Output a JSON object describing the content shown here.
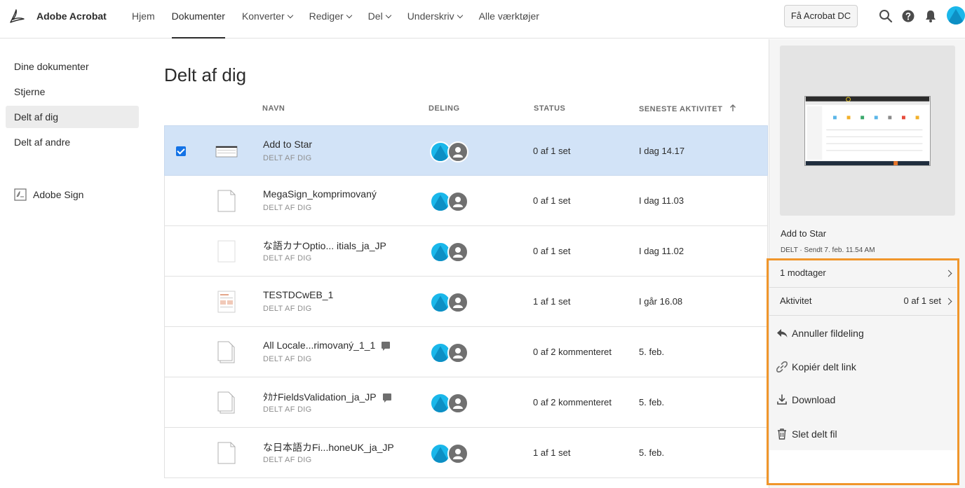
{
  "app": {
    "name": "Adobe Acrobat"
  },
  "nav": {
    "items": [
      {
        "label": "Hjem",
        "dropdown": false
      },
      {
        "label": "Dokumenter",
        "dropdown": false,
        "active": true
      },
      {
        "label": "Konverter",
        "dropdown": true
      },
      {
        "label": "Rediger",
        "dropdown": true
      },
      {
        "label": "Del",
        "dropdown": true
      },
      {
        "label": "Underskriv",
        "dropdown": true
      },
      {
        "label": "Alle værktøjer",
        "dropdown": false
      }
    ],
    "cta_label": "Få Acrobat DC",
    "icons": [
      "search-icon",
      "help-icon",
      "bell-icon",
      "avatar"
    ]
  },
  "sidebar": {
    "items": [
      {
        "label": "Dine dokumenter"
      },
      {
        "label": "Stjerne"
      },
      {
        "label": "Delt af dig",
        "active": true
      },
      {
        "label": "Delt af andre"
      }
    ],
    "sign_label": "Adobe Sign"
  },
  "main": {
    "title": "Delt af dig",
    "columns": {
      "name": "NAVN",
      "sharing": "DELING",
      "status": "STATUS",
      "activity": "SENESTE AKTIVITET"
    },
    "rows": [
      {
        "name": "Add to Star",
        "sub": "DELT AF DIG",
        "status": "0 af 1 set",
        "activity": "I dag 14.17",
        "selected": true,
        "comment": false,
        "thumb": "screenshot"
      },
      {
        "name": "MegaSign_komprimovaný",
        "sub": "DELT AF DIG",
        "status": "0 af 1 set",
        "activity": "I dag 11.03",
        "comment": false,
        "thumb": "doc"
      },
      {
        "name": "な語カナOptio...  itials_ja_JP",
        "sub": "DELT AF DIG",
        "status": "0 af 1 set",
        "activity": "I dag 11.02",
        "comment": false,
        "thumb": "blank"
      },
      {
        "name": "TESTDCwEB_1",
        "sub": "DELT AF DIG",
        "status": "1 af 1 set",
        "activity": "I går 16.08",
        "comment": false,
        "thumb": "form"
      },
      {
        "name": "All Locale...rimovaný_1_1",
        "sub": "DELT AF DIG",
        "status": "0 af 2 kommenteret",
        "activity": "5. feb.",
        "comment": true,
        "thumb": "stack"
      },
      {
        "name": "ﾀｶﾅFieldsValidation_ja_JP",
        "sub": "DELT AF DIG",
        "status": "0 af 2 kommenteret",
        "activity": "5. feb.",
        "comment": true,
        "thumb": "stack"
      },
      {
        "name": "な日本語カFi...honeUK_ja_JP",
        "sub": "DELT AF DIG",
        "status": "1 af 1 set",
        "activity": "5. feb.",
        "comment": false,
        "thumb": "doc"
      }
    ]
  },
  "panel": {
    "title": "Add to Star",
    "meta": "DELT  ·  Sendt 7. feb. 11.54 AM",
    "recipients": "1 modtager",
    "activity_label": "Aktivitet",
    "activity_value": "0 af 1 set",
    "actions": [
      {
        "label": "Annuller fildeling",
        "icon": "unshare-icon"
      },
      {
        "label": "Kopiér delt link",
        "icon": "link-icon"
      },
      {
        "label": "Download",
        "icon": "download-icon"
      },
      {
        "label": "Slet delt fil",
        "icon": "trash-icon"
      }
    ],
    "highlight_color": "#f0962b"
  }
}
